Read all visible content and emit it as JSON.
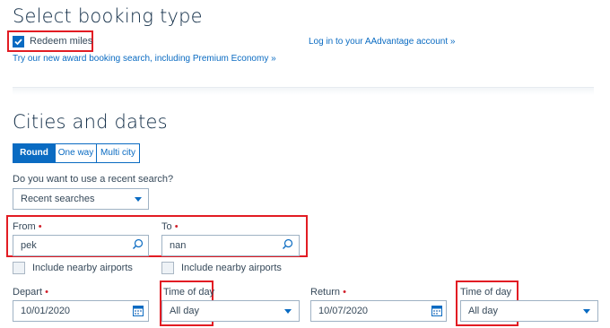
{
  "booking": {
    "title": "Select booking type",
    "redeem_label": "Redeem miles",
    "redeem_checked": true,
    "award_link": "Try our new award booking search, including Premium Economy »",
    "login_link": "Log in to your AAdvantage account »"
  },
  "cities": {
    "title": "Cities and dates",
    "trip_types": [
      "Round trip",
      "One way",
      "Multi city"
    ],
    "selected_trip": "Round trip",
    "recent_prompt": "Do you want to use a recent search?",
    "recent_value": "Recent searches",
    "from_label": "From",
    "from_value": "pek",
    "to_label": "To",
    "to_value": "nan",
    "required_mark": "•",
    "nearby_label": "Include nearby airports",
    "depart_label": "Depart",
    "depart_value": "10/01/2020",
    "time_label": "Time of day",
    "time_value": "All day",
    "return_label": "Return",
    "return_value": "10/07/2020",
    "return_time_label": "Time of day",
    "return_time_value": "All day"
  },
  "colors": {
    "accent": "#0a6bc2",
    "highlight": "#e21c23",
    "required": "#d11f2a"
  }
}
